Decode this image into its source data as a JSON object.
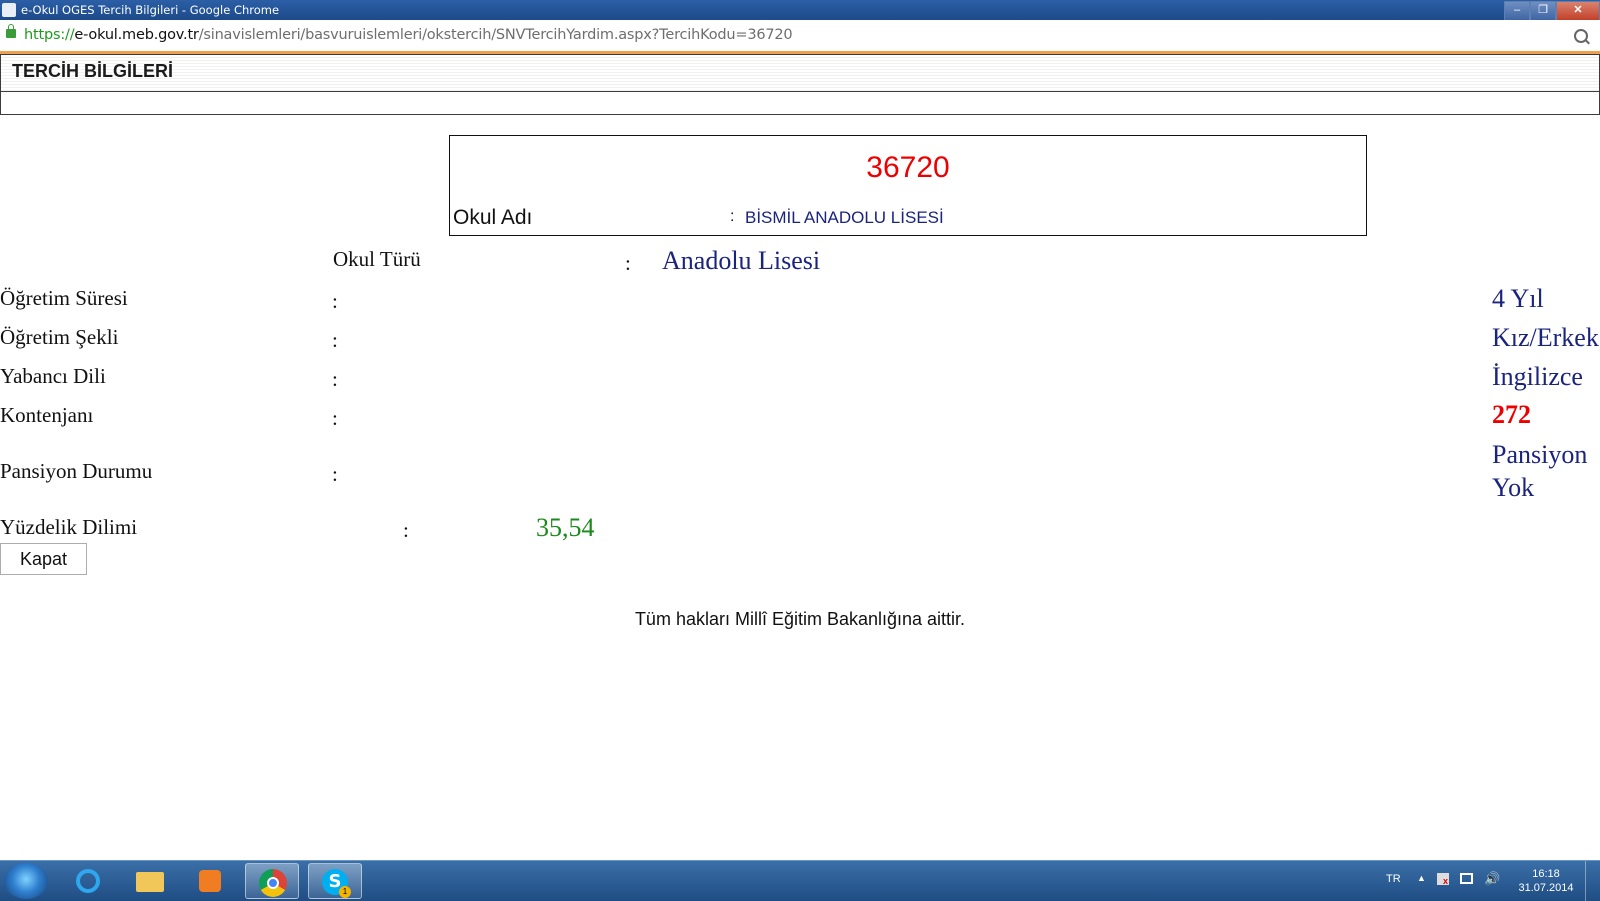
{
  "window": {
    "title": "e-Okul OGES Tercih Bilgileri - Google Chrome",
    "buttons": {
      "minimize": "‒",
      "maximize": "❐",
      "close": "✕"
    }
  },
  "address_bar": {
    "scheme": "https://",
    "host": "e-okul.meb.gov.tr",
    "path": "/sinavislemleri/basvuruislemleri/okstercih/SNVTercihYardim.aspx?TercihKodu=36720"
  },
  "page": {
    "header_title": "TERCİH BİLGİLERİ",
    "code": "36720",
    "okul_adi": {
      "label": "Okul Adı",
      "colon": ":",
      "value": "BİSMİL ANADOLU LİSESİ"
    },
    "okul_turu": {
      "label": "Okul Türü",
      "colon": ":",
      "value": "Anadolu Lisesi"
    },
    "ogretim_suresi": {
      "label": "Öğretim Süresi",
      "colon": ":",
      "value": "4 Yıl"
    },
    "ogretim_sekli": {
      "label": "Öğretim Şekli",
      "colon": ":",
      "value": "Kız/Erkek"
    },
    "yabanci_dili": {
      "label": "Yabancı Dili",
      "colon": ":",
      "value": "İngilizce"
    },
    "kontenjani": {
      "label": "Kontenjanı",
      "colon": ":",
      "value": "272"
    },
    "pansiyon": {
      "label": "Pansiyon Durumu",
      "colon": ":",
      "value_line1": "Pansiyon",
      "value_line2": "Yok"
    },
    "yuzdelik": {
      "label": "Yüzdelik Dilimi",
      "colon": ":",
      "value": "35,54"
    },
    "close_button": "Kapat",
    "footer": "Tüm hakları Millî Eğitim Bakanlığına aittir."
  },
  "taskbar": {
    "skype_badge": "1",
    "skype_letter": "S",
    "language": "TR",
    "tray_arrow": "▲",
    "volume_icon": "🔊",
    "time": "16:18",
    "date": "31.07.2014"
  },
  "colors": {
    "code_red": "#ee0000",
    "value_navy": "#1a237e",
    "percentile_green": "#1b8a1b",
    "address_accent": "#f2a14a"
  },
  "icons": [
    "lock-icon",
    "zoom-icon",
    "chrome-app-icon",
    "windows-start-icon",
    "internet-explorer-icon",
    "folder-icon",
    "media-player-icon",
    "chrome-icon",
    "skype-icon",
    "flag-icon",
    "network-icon",
    "volume-icon"
  ]
}
